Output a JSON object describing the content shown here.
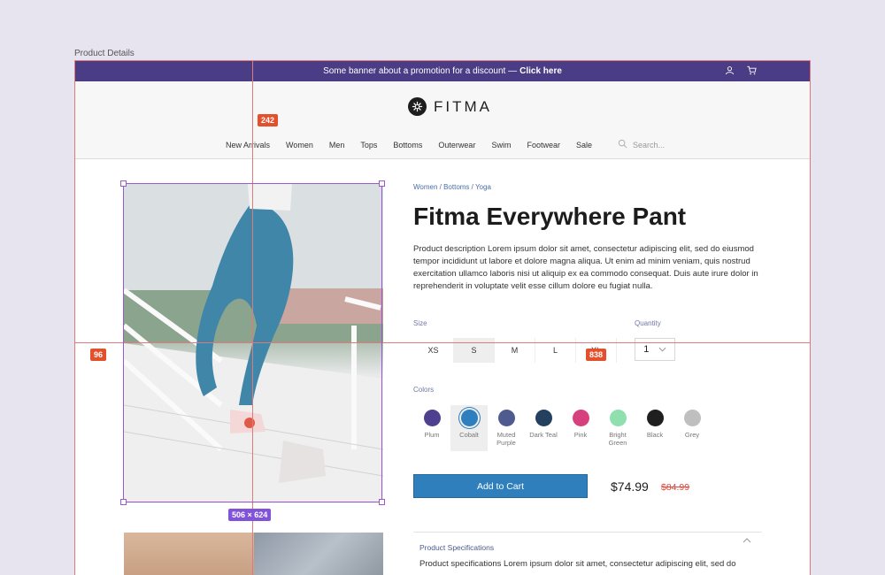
{
  "frame_label": "Product Details",
  "promo": {
    "text": "Some banner about a promotion for a discount —",
    "link": "Click here"
  },
  "header": {
    "logo_text": "FITMA"
  },
  "nav": {
    "items": [
      "New Arrivals",
      "Women",
      "Men",
      "Tops",
      "Bottoms",
      "Outerwear",
      "Swim",
      "Footwear",
      "Sale"
    ],
    "search_placeholder": "Search..."
  },
  "product": {
    "breadcrumb": "Women / Bottoms / Yoga",
    "title": "Fitma Everywhere Pant",
    "description": "Product description Lorem ipsum dolor sit amet, consectetur adipiscing elit, sed do eiusmod tempor incididunt ut labore et dolore magna aliqua. Ut enim ad minim veniam, quis nostrud exercitation ullamco laboris nisi ut aliquip ex ea commodo consequat. Duis aute irure dolor in reprehenderit in voluptate velit esse cillum dolore eu fugiat nulla.",
    "size_label": "Size",
    "sizes": [
      "XS",
      "S",
      "M",
      "L",
      "XL"
    ],
    "selected_size": "S",
    "quantity_label": "Quantity",
    "quantity": "1",
    "colors_label": "Colors",
    "colors": [
      {
        "name": "Plum",
        "hex": "#4f3f8f"
      },
      {
        "name": "Cobalt",
        "hex": "#2f7fbf"
      },
      {
        "name": "Muted Purple",
        "hex": "#4f5b8f"
      },
      {
        "name": "Dark Teal",
        "hex": "#23405f"
      },
      {
        "name": "Pink",
        "hex": "#d6407f"
      },
      {
        "name": "Bright Green",
        "hex": "#8fdfaf"
      },
      {
        "name": "Black",
        "hex": "#1f1f1f"
      },
      {
        "name": "Grey",
        "hex": "#bfbfbf"
      }
    ],
    "selected_color": "Cobalt",
    "add_to_cart": "Add to Cart",
    "price": "$74.99",
    "old_price": "$84.99",
    "specs_title": "Product Specifications",
    "specs_text": "Product specifications Lorem ipsum dolor sit amet, consectetur adipiscing elit, sed do"
  },
  "overlay": {
    "tag_top": "242",
    "tag_left": "96",
    "tag_right": "838",
    "tag_size": "506 × 624",
    "accent": "#e2502e",
    "selection": "#8153d8"
  }
}
